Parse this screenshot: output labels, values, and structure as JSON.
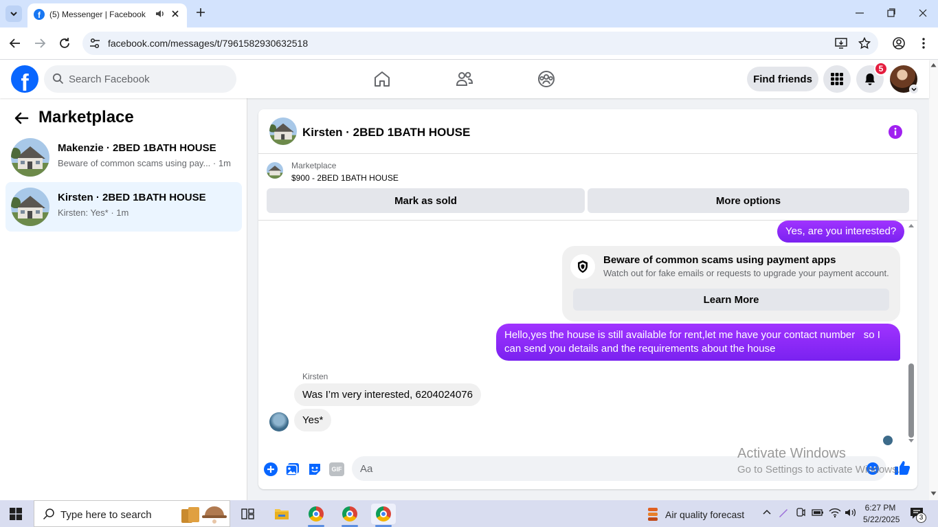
{
  "browser": {
    "tab_title": "(5) Messenger | Facebook",
    "url": "facebook.com/messages/t/7961582930632518"
  },
  "facebook": {
    "logo_letter": "f",
    "search_placeholder": "Search Facebook",
    "find_friends_label": "Find friends",
    "notification_count": "5"
  },
  "sidebar": {
    "title": "Marketplace",
    "conversations": [
      {
        "name": "Makenzie · 2BED 1BATH HOUSE",
        "preview": "Beware of common scams using pay... · 1m",
        "active": false
      },
      {
        "name": "Kirsten · 2BED 1BATH HOUSE",
        "preview": "Kirsten: Yes* · 1m",
        "active": true
      }
    ]
  },
  "chat": {
    "header_name": "Kirsten · 2BED 1BATH HOUSE",
    "listing_source": "Marketplace",
    "listing_title": "$900 - 2BED 1BATH HOUSE",
    "mark_sold_label": "Mark as sold",
    "more_options_label": "More options",
    "messages": {
      "out_1": "Yes, are you interested?",
      "scam_title": "Beware of common scams using payment apps",
      "scam_text": "Watch out for fake emails or requests to upgrade your payment account.",
      "scam_button": "Learn More",
      "out_2_line1": "Hello,yes the house is still available for rent,let me have your contact number   so I",
      "out_2_line2": "can send you details and the requirements about the house",
      "sender_name": "Kirsten",
      "in_1": "Was I’m very interested, 6204024076",
      "in_2": "Yes*"
    },
    "composer_placeholder": "Aa",
    "gif_label": "GIF"
  },
  "watermark": {
    "line1": "Activate Windows",
    "line2": "Go to Settings to activate Windows."
  },
  "taskbar": {
    "search_text": "Type here to search",
    "weather_text": "Air quality forecast",
    "time": "6:27 PM",
    "date": "5/22/2025",
    "notification_count": "3"
  },
  "colors": {
    "fb_blue": "#0866ff",
    "message_purple": "#a033ff",
    "notification_red": "#e41e3f",
    "active_conversation": "#ebf5ff"
  }
}
